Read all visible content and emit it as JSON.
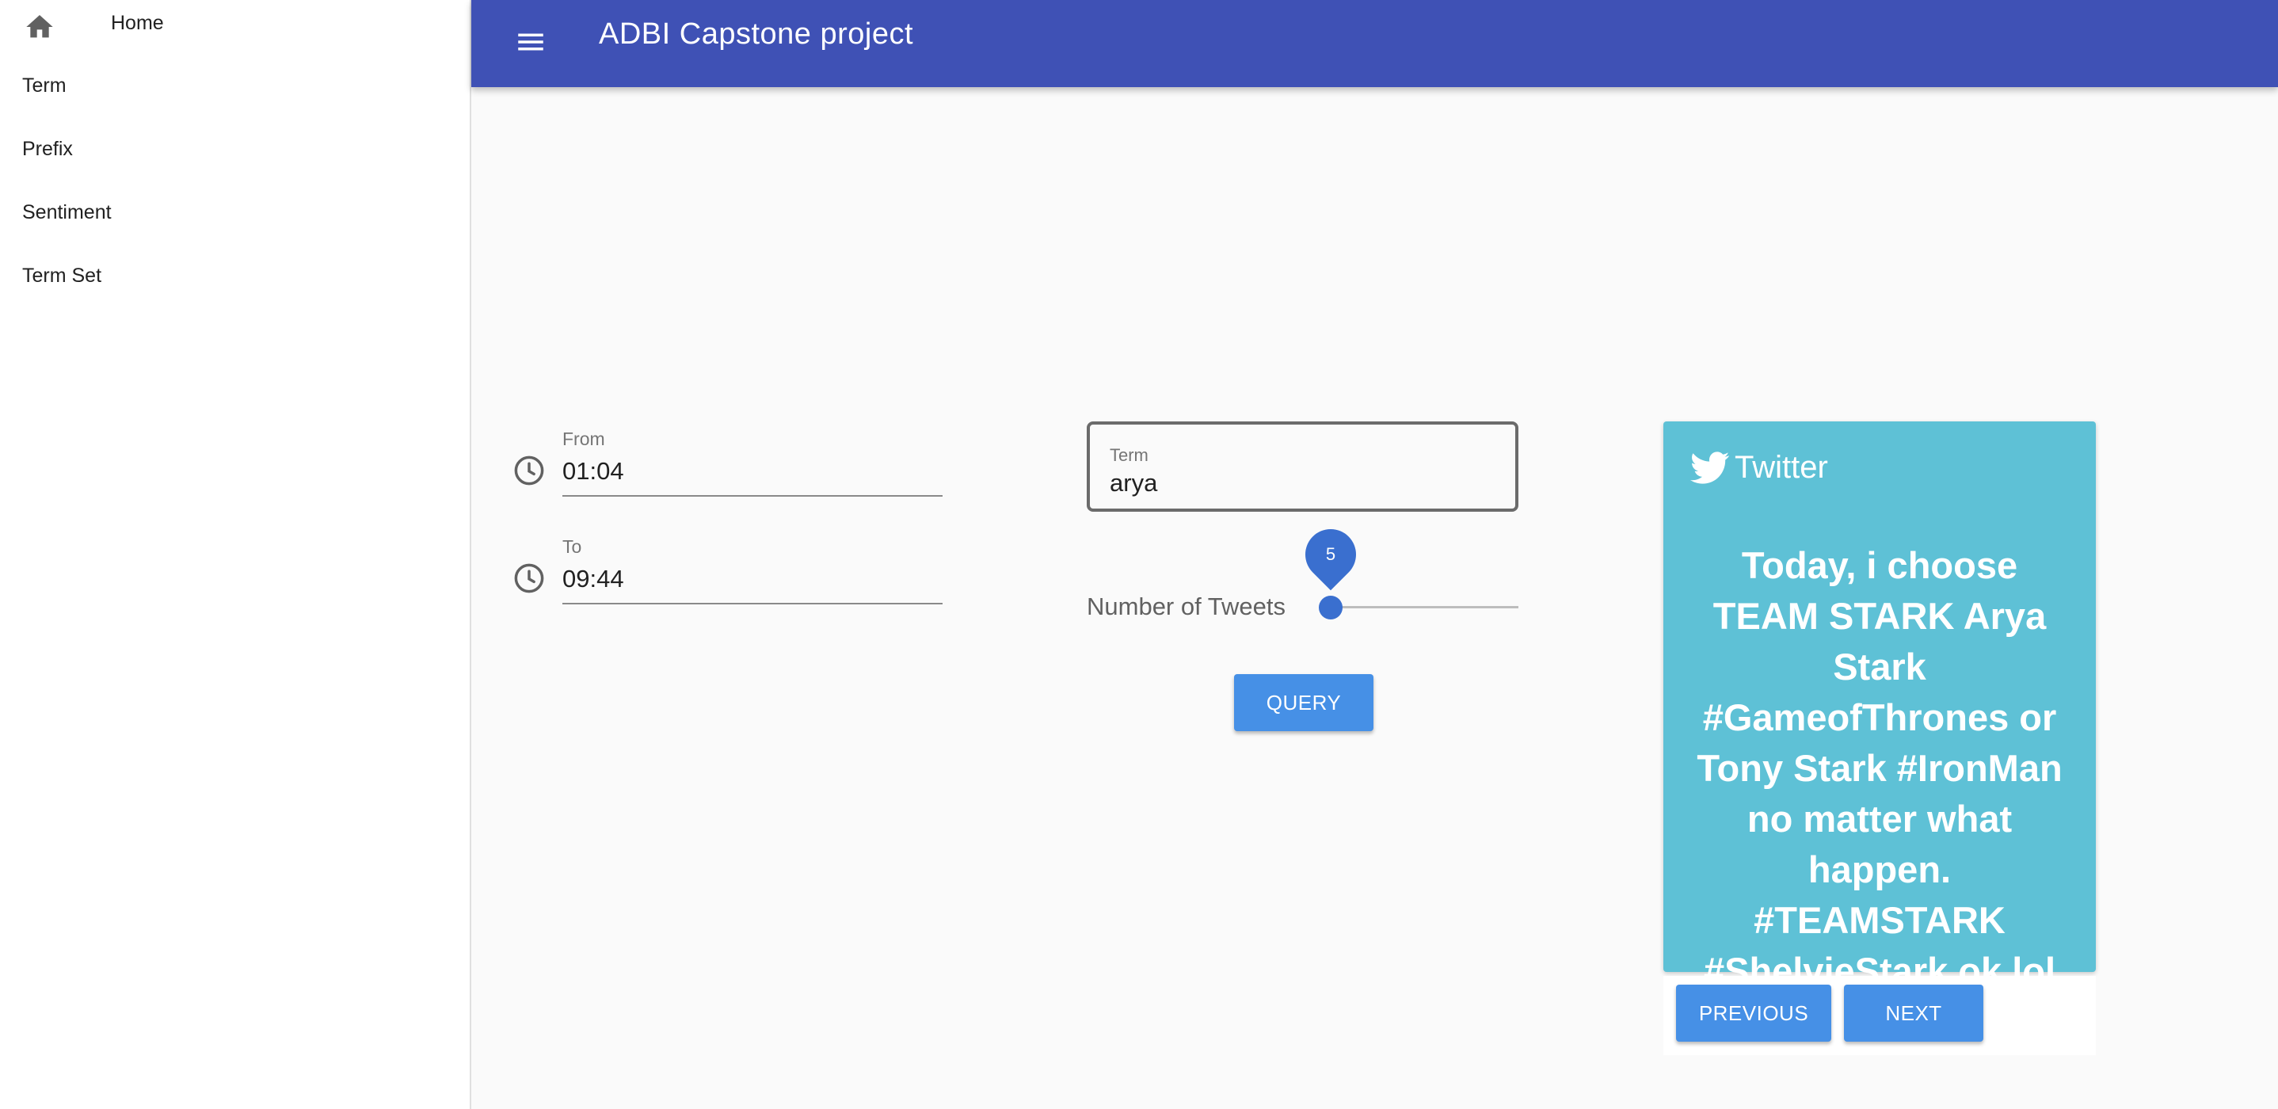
{
  "app": {
    "title": "ADBI Capstone project"
  },
  "sidebar": {
    "items": [
      {
        "label": "Home",
        "icon": "home-icon"
      },
      {
        "label": "Term"
      },
      {
        "label": "Prefix"
      },
      {
        "label": "Sentiment"
      },
      {
        "label": "Term Set"
      }
    ]
  },
  "filters": {
    "from": {
      "label": "From",
      "value": "01:04",
      "icon": "clock-icon"
    },
    "to": {
      "label": "To",
      "value": "09:44",
      "icon": "clock-icon"
    },
    "term": {
      "label": "Term",
      "value": "arya"
    },
    "tweets": {
      "label": "Number of Tweets",
      "value": "5"
    },
    "query_label": "QUERY"
  },
  "twitter": {
    "label": "Twitter",
    "icon": "twitter-bird-icon",
    "tweet_text": "Today, i choose TEAM STARK Arya Stark #GameofThrones or Tony Stark #IronMan no matter what happen. #TEAMSTARK #ShelvieStark ok lol",
    "previous_label": "PREVIOUS",
    "next_label": "NEXT"
  },
  "colors": {
    "appbar": "#3f51b5",
    "button": "#4690e6",
    "card": "#5ec1d6",
    "slider": "#3a6fcf"
  }
}
